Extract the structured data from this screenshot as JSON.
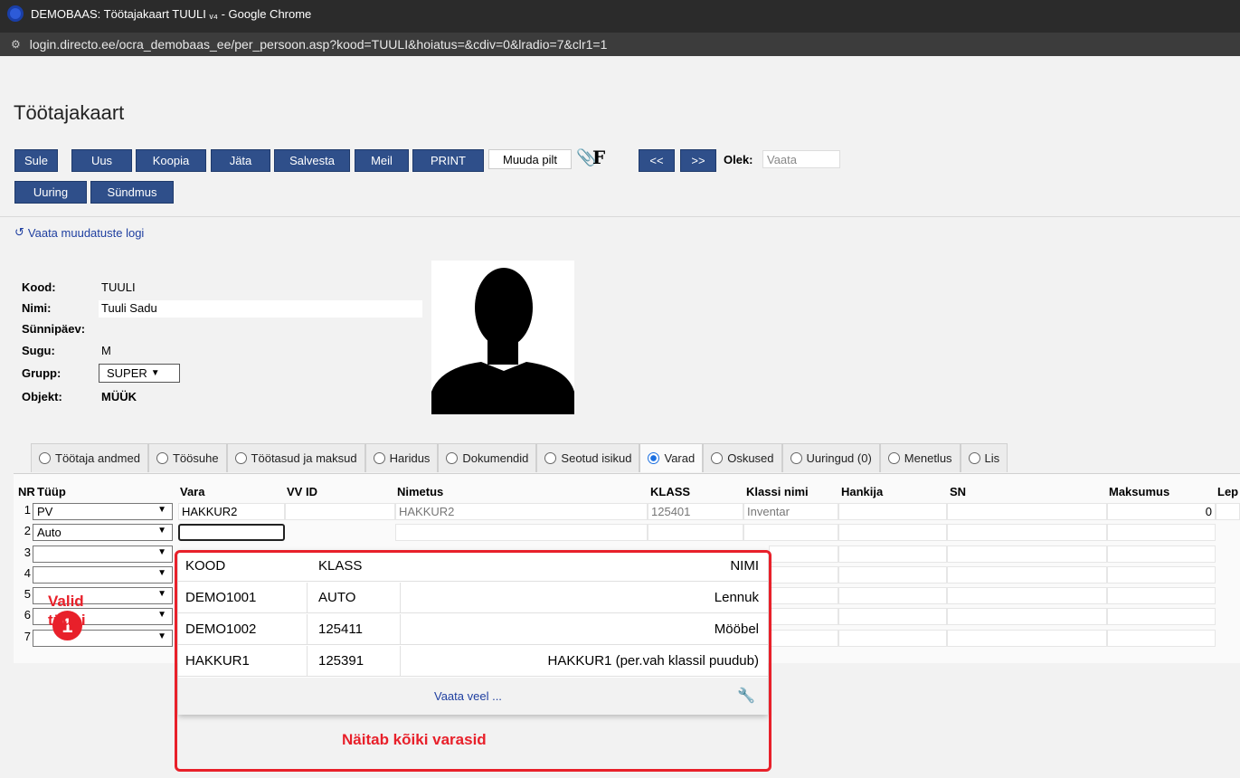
{
  "browser": {
    "window_title": "DEMOBAAS: Töötajakaart TUULI ᵥ₄ - Google Chrome",
    "url": "login.directo.ee/ocra_demobaas_ee/per_persoon.asp?kood=TUULI&hoiatus=&cdiv=0&lradio=7&clr1=1"
  },
  "page": {
    "title": "Töötajakaart",
    "log_link": "Vaata muudatuste logi"
  },
  "toolbar": {
    "buttons": [
      "Sule",
      "Uus",
      "Koopia",
      "Jäta",
      "Salvesta",
      "Meil",
      "PRINT"
    ],
    "muuda_pilt": "Muuda pilt",
    "f_label": "F",
    "prev": "<<",
    "next": ">>",
    "olek_label": "Olek:",
    "olek_value": "Vaata",
    "row2_buttons": [
      "Uuring",
      "Sündmus"
    ]
  },
  "person": {
    "labels": {
      "kood": "Kood:",
      "nimi": "Nimi:",
      "synnipaev": "Sünnipäev:",
      "sugu": "Sugu:",
      "grupp": "Grupp:",
      "objekt": "Objekt:"
    },
    "kood": "TUULI",
    "nimi": "Tuuli Sadu",
    "sugu": "M",
    "grupp": "SUPER",
    "objekt": "MÜÜK"
  },
  "tabs": [
    {
      "label": "Töötaja andmed",
      "active": false
    },
    {
      "label": "Töösuhe",
      "active": false
    },
    {
      "label": "Töötasud ja maksud",
      "active": false
    },
    {
      "label": "Haridus",
      "active": false
    },
    {
      "label": "Dokumendid",
      "active": false
    },
    {
      "label": "Seotud isikud",
      "active": false
    },
    {
      "label": "Varad",
      "active": true
    },
    {
      "label": "Oskused",
      "active": false
    },
    {
      "label": "Uuringud (0)",
      "active": false
    },
    {
      "label": "Menetlus",
      "active": false
    },
    {
      "label": "Lis",
      "active": false
    }
  ],
  "grid": {
    "headers": {
      "nr": "NR",
      "tuup": "Tüüp",
      "vara": "Vara",
      "vvid": "VV ID",
      "nimetus": "Nimetus",
      "klass": "KLASS",
      "klassi_nimi": "Klassi nimi",
      "hankija": "Hankija",
      "sn": "SN",
      "maksumus": "Maksumus",
      "lep": "Lep"
    },
    "rows": [
      {
        "nr": "1",
        "tuup": "PV",
        "vara": "HAKKUR2",
        "nimetus": "HAKKUR2",
        "klass": "125401",
        "klassi_nimi": "Inventar",
        "maksumus": "0"
      },
      {
        "nr": "2",
        "tuup": "Auto",
        "vara": ""
      },
      {
        "nr": "3",
        "tuup": ""
      },
      {
        "nr": "4",
        "tuup": ""
      },
      {
        "nr": "5",
        "tuup": ""
      },
      {
        "nr": "6",
        "tuup": ""
      },
      {
        "nr": "7",
        "tuup": ""
      }
    ]
  },
  "popup": {
    "headers": {
      "kood": "KOOD",
      "klass": "KLASS",
      "nimi": "NIMI"
    },
    "rows": [
      {
        "kood": "DEMO1001",
        "klass": "AUTO",
        "nimi": "Lennuk"
      },
      {
        "kood": "DEMO1002",
        "klass": "125411",
        "nimi": "Mööbel"
      },
      {
        "kood": "HAKKUR1",
        "klass": "125391",
        "nimi": "HAKKUR1 (per.vah klassil puudub)"
      }
    ],
    "more": "Vaata veel ..."
  },
  "annotations": {
    "badge": "1",
    "valid": "Valid",
    "tuubi": "tüübi",
    "note": "Näitab kõiki varasid",
    "color": "#e8202a"
  }
}
